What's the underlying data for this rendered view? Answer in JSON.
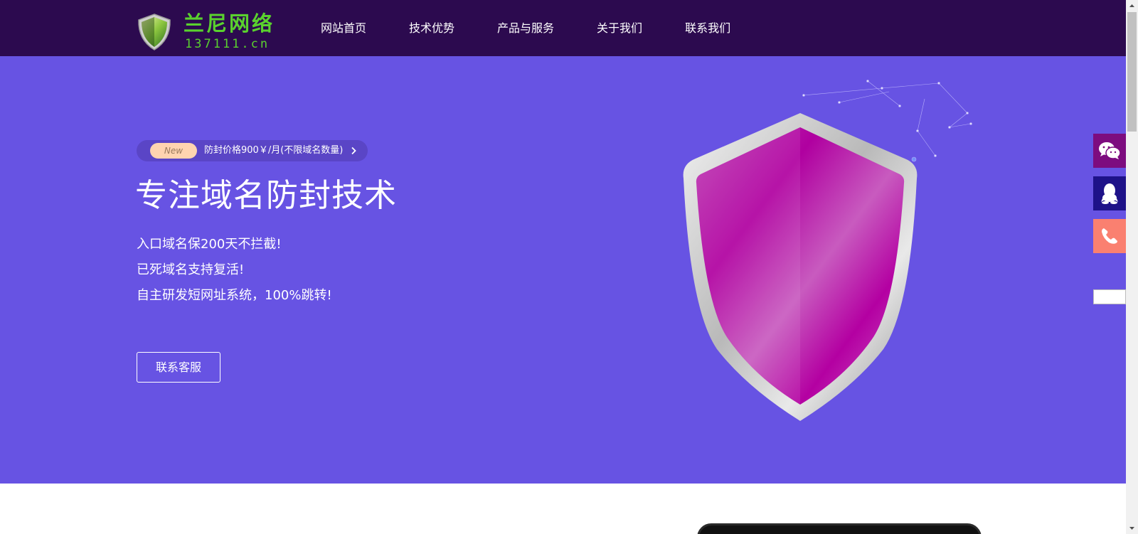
{
  "header": {
    "logo_title": "兰尼网络",
    "logo_domain": "137111.cn",
    "nav": [
      {
        "label": "网站首页"
      },
      {
        "label": "技术优势"
      },
      {
        "label": "产品与服务"
      },
      {
        "label": "关于我们"
      },
      {
        "label": "联系我们"
      }
    ]
  },
  "hero": {
    "badge_new": "New",
    "badge_text": "防封价格900￥/月(不限域名数量)",
    "title": "专注域名防封技术",
    "lines": [
      "入口域名保200天不拦截!",
      "已死域名支持复活!",
      "自主研发短网址系统，100%跳转!"
    ],
    "contact_button": "联系客服"
  },
  "side_buttons": [
    "wechat-icon",
    "qq-icon",
    "phone-icon"
  ],
  "colors": {
    "header_bg": "#2c0a4f",
    "hero_bg": "#6753e3",
    "logo_green": "#5ad12e",
    "shield_magenta": "#b5009b",
    "wechat_bg": "#7d0c7f",
    "qq_bg": "#1e1289",
    "phone_bg": "#fa8070"
  }
}
